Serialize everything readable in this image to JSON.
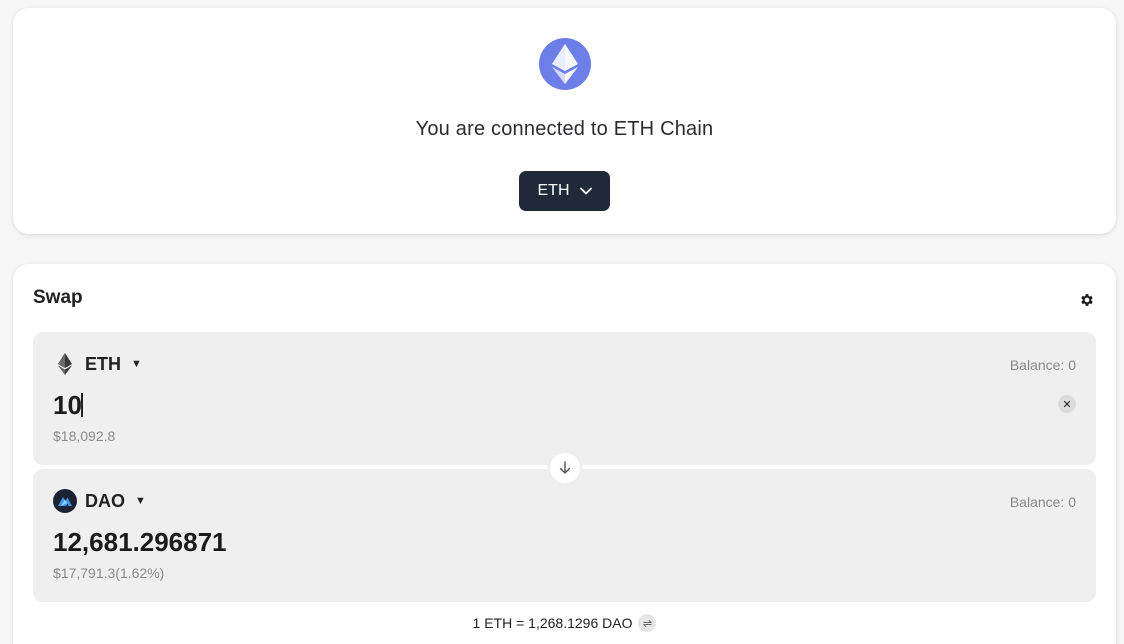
{
  "network": {
    "connected_text": "You are connected to ETH Chain",
    "chain_selector_label": "ETH",
    "logo_color": "#6c7fe8"
  },
  "swap": {
    "title": "Swap",
    "from": {
      "token": "ETH",
      "balance": "Balance: 0",
      "amount": "10",
      "usd_value": "$18,092.8"
    },
    "to": {
      "token": "DAO",
      "balance": "Balance: 0",
      "amount": "12,681.296871",
      "usd_value": "$17,791.3(1.62%)"
    },
    "rate": "1 ETH = 1,268.1296 DAO"
  },
  "colors": {
    "button_dark": "#1f2937",
    "panel_bg": "#efefef",
    "muted_text": "#8a8a8a"
  }
}
